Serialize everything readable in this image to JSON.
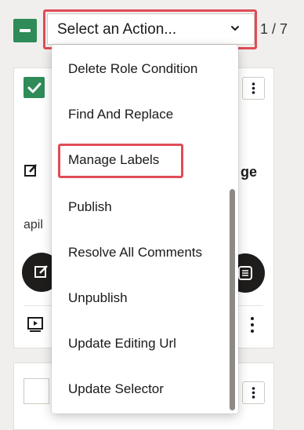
{
  "toolbar": {
    "select_label": "Select an Action...",
    "page_count": "1 / 7"
  },
  "card": {
    "title_fragment": "ge",
    "sub_fragment": "apil"
  },
  "menu": {
    "items": [
      "Delete Role Condition",
      "Find And Replace",
      "Manage Labels",
      "Publish",
      "Resolve All Comments",
      "Unpublish",
      "Update Editing Url",
      "Update Selector"
    ],
    "highlighted": "Manage Labels"
  },
  "colors": {
    "accent_green": "#2f8b57",
    "highlight_red": "#e04c57"
  },
  "icons": [
    "minus-icon",
    "chevron-down-icon",
    "check-icon",
    "kebab-icon",
    "edit-icon",
    "comment-icon",
    "preview-icon"
  ]
}
